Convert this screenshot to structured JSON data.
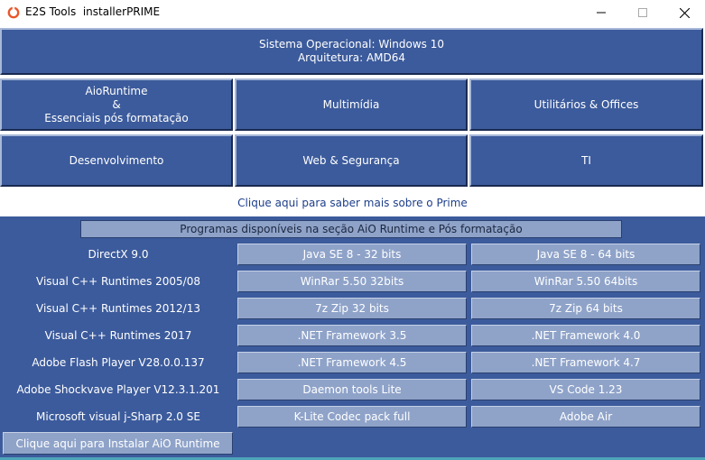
{
  "window": {
    "title": "E2S Tools  installerPRIME"
  },
  "system_info": {
    "os": "Sistema Operacional: Windows 10",
    "arch": "Arquitetura: AMD64"
  },
  "categories": {
    "aio": [
      "AioRuntime",
      "&",
      "Essenciais pós formatação"
    ],
    "multimedia": "Multimídia",
    "utilities": "Utilitários & Offices",
    "development": "Desenvolvimento",
    "web_security": "Web & Segurança",
    "ti": "TI"
  },
  "info_link": "Clique aqui para saber mais sobre o Prime",
  "section_header": "Programas disponíveis na seção AiO Runtime e  Pós formatação",
  "runtime_rows": [
    {
      "label": "DirectX 9.0",
      "left": "Java SE 8 - 32 bits",
      "right": "Java SE 8 - 64 bits"
    },
    {
      "label": "Visual C++ Runtimes 2005/08",
      "left": "WinRar 5.50 32bits",
      "right": "WinRar 5.50 64bits"
    },
    {
      "label": "Visual C++ Runtimes 2012/13",
      "left": "7z Zip 32 bits",
      "right": "7z Zip 64 bits"
    },
    {
      "label": "Visual C++ Runtimes 2017",
      "left": ".NET Framework 3.5",
      "right": ".NET Framework 4.0"
    },
    {
      "label": "Adobe Flash Player V28.0.0.137",
      "left": ".NET Framework 4.5",
      "right": ".NET Framework 4.7"
    },
    {
      "label": "Adobe Shockvave Player V12.3.1.201",
      "left": "Daemon tools Lite",
      "right": "VS Code 1.23"
    },
    {
      "label": "Microsoft visual j-Sharp 2.0 SE",
      "left": "K-Lite Codec pack full",
      "right": "Adobe Air"
    }
  ],
  "install_button": "Clique aqui para Instalar AiO Runtime",
  "colors": {
    "panel_blue": "#3c5b9c",
    "button_light": "#8fa3c9",
    "link_blue": "#1e3f8a"
  }
}
